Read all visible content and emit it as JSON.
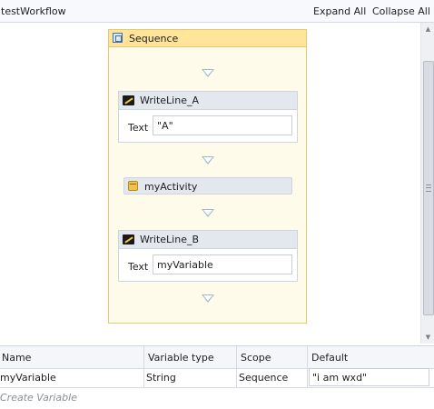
{
  "header": {
    "title": "testWorkflow",
    "expand_all": "Expand All",
    "collapse_all": "Collapse All"
  },
  "sequence": {
    "title": "Sequence",
    "icon": "sequence-icon"
  },
  "activities": {
    "writeline_a": {
      "title": "WriteLine_A",
      "field_label": "Text",
      "value": "\"A\"",
      "icon": "writeline-icon"
    },
    "my_activity": {
      "title": "myActivity",
      "icon": "activity-icon"
    },
    "writeline_b": {
      "title": "WriteLine_B",
      "field_label": "Text",
      "value": "myVariable",
      "icon": "writeline-icon"
    }
  },
  "variables": {
    "columns": {
      "name": "Name",
      "type": "Variable type",
      "scope": "Scope",
      "default": "Default"
    },
    "rows": [
      {
        "name": "myVariable",
        "type": "String",
        "scope": "Sequence",
        "default": "\"i am wxd\""
      }
    ],
    "create_label": "Create Variable"
  },
  "colors": {
    "sequence_bg": "#fffbea",
    "sequence_border": "#e9c96a",
    "sequence_header": "#ffe49a",
    "activity_header": "#e3e7ee",
    "connector": "#a6b7cc"
  }
}
